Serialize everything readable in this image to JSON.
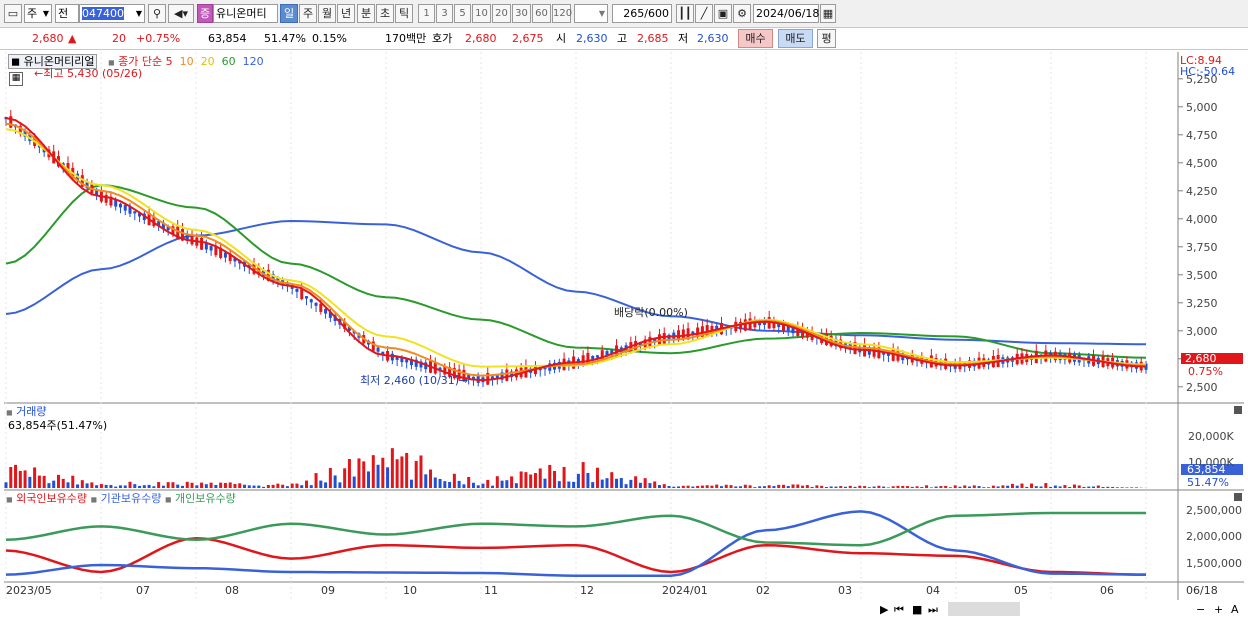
{
  "toolbar": {
    "market_select": "주",
    "scope_select": "전",
    "code": "047400",
    "kind_badge": "증",
    "name": "유니온머티",
    "periods": [
      "일",
      "주",
      "월",
      "년",
      "분",
      "초",
      "틱"
    ],
    "period_active": "일",
    "intervals": [
      "1",
      "3",
      "5",
      "10",
      "20",
      "30",
      "60",
      "120"
    ],
    "count": "265",
    "count_total": "/600",
    "date": "2024/06/18"
  },
  "quote": {
    "price": "2,680",
    "change": "20",
    "change_pct": "+0.75%",
    "volume": "63,854",
    "volume_ratio": "51.47%",
    "turnover": "0.15%",
    "amount": "170백만",
    "ask_label": "호가",
    "ask1": "2,680",
    "ask2": "2,675",
    "open_label": "시",
    "open": "2,630",
    "high_label": "고",
    "high": "2,685",
    "low_label": "저",
    "low": "2,630",
    "buy": "매수",
    "sell": "매도",
    "avg": "평"
  },
  "price_panel": {
    "name": "유니온머티리얼",
    "ma_label": "종가 단순",
    "ma_periods": [
      "5",
      "10",
      "20",
      "60",
      "120"
    ],
    "high_note": "최고 5,430 (05/26)",
    "low_note": "최저 2,460 (10/31)",
    "dividend_note": "배당락(0.00%)",
    "lc": "LC:8.94",
    "hc": "HC:-50.64",
    "y_ticks": [
      "5,250",
      "5,000",
      "4,750",
      "4,500",
      "4,250",
      "4,000",
      "3,750",
      "3,500",
      "3,250",
      "3,000",
      "2,750",
      "2,500"
    ],
    "last_price": "2,680",
    "last_pct": "0.75%"
  },
  "volume_panel": {
    "title": "거래량",
    "value": "63,854주(51.47%)",
    "y_ticks": [
      "20,000K",
      "10,000K"
    ],
    "last": "63,854",
    "last_pct": "51.47%"
  },
  "holding_panel": {
    "legend": [
      "외국인보유수량",
      "기관보유수량",
      "개인보유수량"
    ],
    "y_ticks": [
      "2,500,000",
      "2,000,000",
      "1,500,000"
    ]
  },
  "x_axis": {
    "labels": [
      "2023/05",
      "07",
      "08",
      "09",
      "10",
      "11",
      "12",
      "2024/01",
      "02",
      "03",
      "04",
      "05",
      "06"
    ],
    "right_label": "06/18"
  },
  "colors": {
    "up": "#e0161b",
    "down": "#1f4fd6",
    "ma5": "#e0161b",
    "ma10": "#f28a1c",
    "ma20": "#f0e21e",
    "ma60": "#2a9a2a",
    "ma120": "#3a62d8",
    "foreign": "#e0161b",
    "institution": "#3a62d8",
    "individual": "#3a9a5a"
  },
  "chart_data": [
    {
      "type": "line",
      "title": "유니온머티리얼",
      "series": [
        {
          "name": "5",
          "x": [
            "2023/05",
            "07",
            "08",
            "09",
            "10",
            "11",
            "12",
            "2024/01",
            "02",
            "03",
            "04",
            "05",
            "06"
          ],
          "values": [
            4900,
            4200,
            3800,
            3400,
            2780,
            2560,
            2720,
            2950,
            3080,
            2830,
            2690,
            2780,
            2680
          ]
        },
        {
          "name": "10",
          "x": [
            "2023/05",
            "07",
            "08",
            "09",
            "10",
            "11",
            "12",
            "2024/01",
            "02",
            "03",
            "04",
            "05",
            "06"
          ],
          "values": [
            4850,
            4250,
            3850,
            3420,
            2850,
            2600,
            2700,
            2920,
            3090,
            2850,
            2700,
            2770,
            2690
          ]
        },
        {
          "name": "20",
          "x": [
            "2023/05",
            "07",
            "08",
            "09",
            "10",
            "11",
            "12",
            "2024/01",
            "02",
            "03",
            "04",
            "05",
            "06"
          ],
          "values": [
            4800,
            4300,
            3900,
            3450,
            2950,
            2680,
            2690,
            2880,
            3100,
            2880,
            2720,
            2760,
            2700
          ]
        },
        {
          "name": "60",
          "x": [
            "2023/05",
            "07",
            "08",
            "09",
            "10",
            "11",
            "12",
            "2024/01",
            "02",
            "03",
            "04",
            "05",
            "06"
          ],
          "values": [
            3600,
            4300,
            4100,
            3600,
            3300,
            3100,
            2850,
            2800,
            2930,
            2980,
            2950,
            2800,
            2760
          ]
        },
        {
          "name": "120",
          "x": [
            "2023/05",
            "07",
            "08",
            "09",
            "10",
            "11",
            "12",
            "2024/01",
            "02",
            "03",
            "04",
            "05",
            "06"
          ],
          "values": [
            3150,
            3550,
            3850,
            3980,
            3950,
            3700,
            3350,
            3130,
            3000,
            2960,
            2920,
            2890,
            2880
          ]
        }
      ],
      "ylim": [
        2400,
        5400
      ]
    },
    {
      "type": "bar",
      "title": "거래량",
      "categories": [
        "2023/05",
        "07",
        "08",
        "09",
        "10",
        "11",
        "12",
        "2024/01",
        "02",
        "03",
        "04",
        "05",
        "06"
      ],
      "values": [
        14000,
        3000,
        3500,
        2000,
        23000,
        4000,
        15000,
        1500,
        2000,
        1200,
        1500,
        2500,
        64
      ]
    },
    {
      "type": "line",
      "series": [
        {
          "name": "외국인보유수량",
          "x": [
            "2023/05",
            "07",
            "08",
            "09",
            "10",
            "11",
            "12",
            "2024/01",
            "02",
            "03",
            "04",
            "05",
            "06"
          ],
          "values": [
            1850000,
            1450000,
            2080000,
            1700000,
            1950000,
            1900000,
            1950000,
            1450000,
            1950000,
            1800000,
            1750000,
            1450000,
            1400000
          ]
        },
        {
          "name": "기관보유수량",
          "x": [
            "2023/05",
            "07",
            "08",
            "09",
            "10",
            "11",
            "12",
            "2024/01",
            "02",
            "03",
            "04",
            "05",
            "06"
          ],
          "values": [
            1400000,
            1580000,
            1520000,
            1450000,
            1440000,
            1430000,
            1380000,
            1380000,
            2230000,
            2580000,
            1850000,
            1420000,
            1400000
          ]
        },
        {
          "name": "개인보유수량",
          "x": [
            "2023/05",
            "07",
            "08",
            "09",
            "10",
            "11",
            "12",
            "2024/01",
            "02",
            "03",
            "04",
            "05",
            "06"
          ],
          "values": [
            2050000,
            2300000,
            2050000,
            2350000,
            2150000,
            2350000,
            2300000,
            2500000,
            2000000,
            1950000,
            2500000,
            2550000,
            2550000
          ]
        }
      ],
      "ylim": [
        1300000,
        2700000
      ]
    }
  ]
}
